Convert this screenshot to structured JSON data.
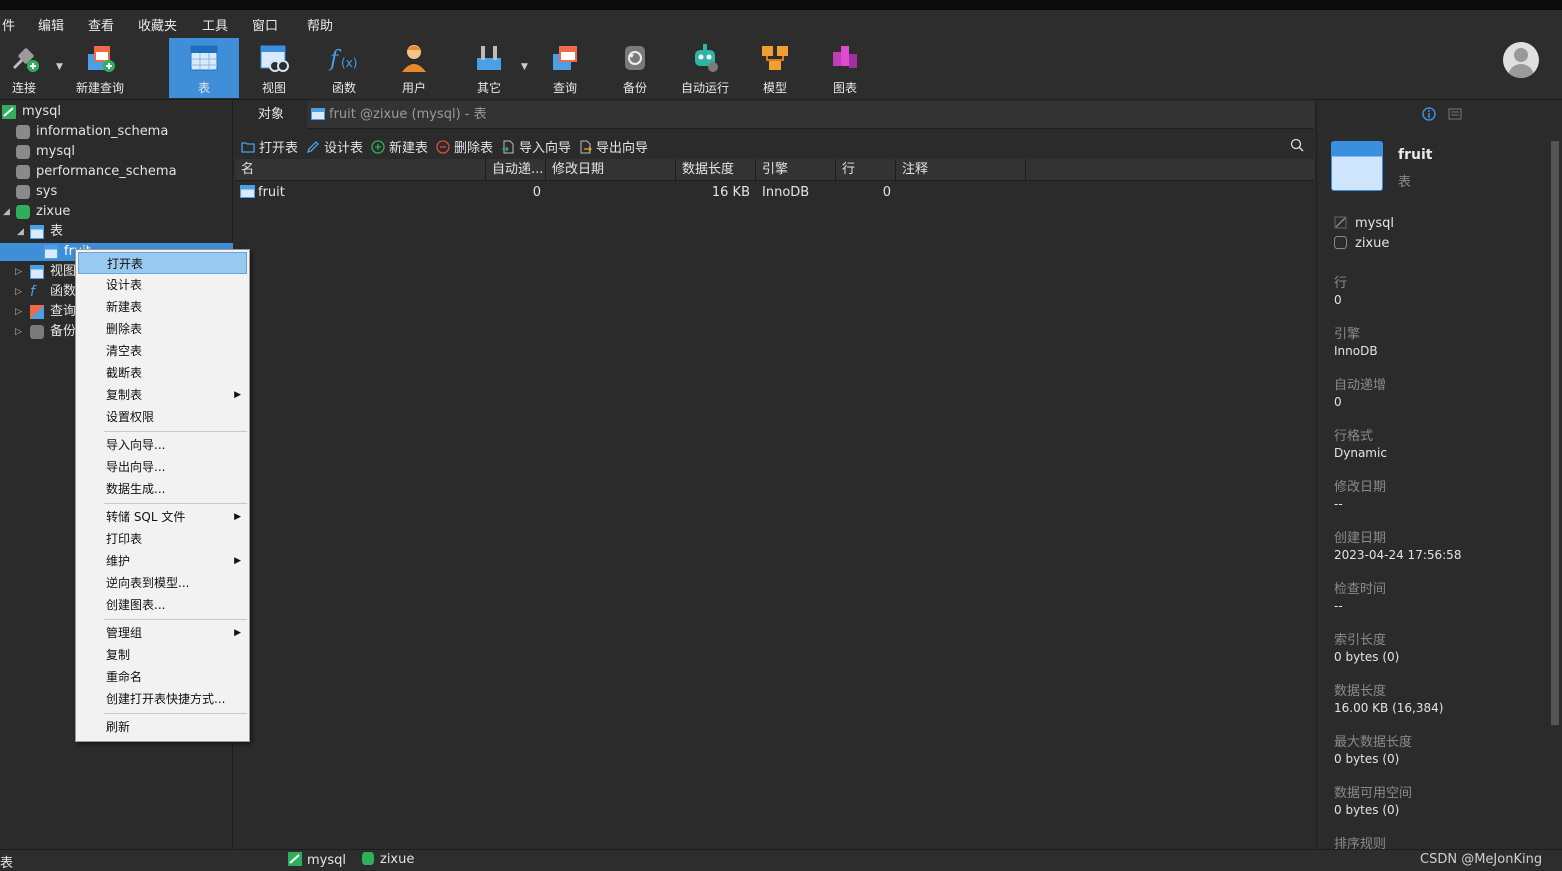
{
  "menu": [
    "件",
    "编辑",
    "查看",
    "收藏夹",
    "工具",
    "窗口",
    "帮助"
  ],
  "toolbar": {
    "connect": "连接",
    "new_query": "新建查询",
    "table": "表",
    "view": "视图",
    "function": "函数",
    "user": "用户",
    "other": "其它",
    "query": "查询",
    "backup": "备份",
    "auto_run": "自动运行",
    "model": "模型",
    "chart": "图表"
  },
  "sidebar": {
    "connection": "mysql",
    "databases": [
      "information_schema",
      "mysql",
      "performance_schema",
      "sys",
      "zixue"
    ],
    "zixue_children": {
      "tables": "表",
      "table_item": "fruit",
      "views": "视图",
      "functions": "函数",
      "queries": "查询",
      "backups": "备份"
    }
  },
  "tabs": {
    "objects": "对象",
    "fruit_tab": "fruit @zixue (mysql) - 表"
  },
  "actions": {
    "open_table": "打开表",
    "design_table": "设计表",
    "new_table": "新建表",
    "delete_table": "删除表",
    "import_wizard": "导入向导",
    "export_wizard": "导出向导"
  },
  "grid": {
    "headers": [
      "名",
      "自动递...",
      "修改日期",
      "数据长度",
      "引擎",
      "行",
      "注释"
    ],
    "rows": [
      {
        "name": "fruit",
        "auto_inc": "0",
        "modified": "",
        "data_length": "16 KB",
        "engine": "InnoDB",
        "rows": "0",
        "comment": ""
      }
    ]
  },
  "context_menu": {
    "items": [
      {
        "label": "打开表"
      },
      {
        "label": "设计表"
      },
      {
        "label": "新建表"
      },
      {
        "label": "删除表"
      },
      {
        "label": "清空表"
      },
      {
        "label": "截断表"
      },
      {
        "label": "复制表"
      },
      {
        "label": "设置权限"
      },
      {
        "label": "导入向导..."
      },
      {
        "label": "导出向导..."
      },
      {
        "label": "数据生成..."
      },
      {
        "label": "转储 SQL 文件"
      },
      {
        "label": "打印表"
      },
      {
        "label": "维护"
      },
      {
        "label": "逆向表到模型..."
      },
      {
        "label": "创建图表..."
      },
      {
        "label": "管理组"
      },
      {
        "label": "复制"
      },
      {
        "label": "重命名"
      },
      {
        "label": "创建打开表快捷方式..."
      },
      {
        "label": "刷新"
      }
    ]
  },
  "right_panel": {
    "name": "fruit",
    "type": "表",
    "connection": "mysql",
    "database": "zixue",
    "props": [
      {
        "label": "行",
        "value": "0"
      },
      {
        "label": "引擎",
        "value": "InnoDB"
      },
      {
        "label": "自动递增",
        "value": "0"
      },
      {
        "label": "行格式",
        "value": "Dynamic"
      },
      {
        "label": "修改日期",
        "value": "--"
      },
      {
        "label": "创建日期",
        "value": "2023-04-24 17:56:58"
      },
      {
        "label": "检查时间",
        "value": "--"
      },
      {
        "label": "索引长度",
        "value": "0 bytes (0)"
      },
      {
        "label": "数据长度",
        "value": "16.00 KB (16,384)"
      },
      {
        "label": "最大数据长度",
        "value": "0 bytes (0)"
      },
      {
        "label": "数据可用空间",
        "value": "0 bytes (0)"
      },
      {
        "label": "排序规则",
        "value": ""
      }
    ]
  },
  "status": {
    "left": "表",
    "connection": "mysql",
    "database": "zixue",
    "watermark": "CSDN @MeJonKing"
  },
  "colors": {
    "accent": "#3e8fd8",
    "background": "#2b2b2b",
    "menu_highlight": "#99c9ef"
  }
}
